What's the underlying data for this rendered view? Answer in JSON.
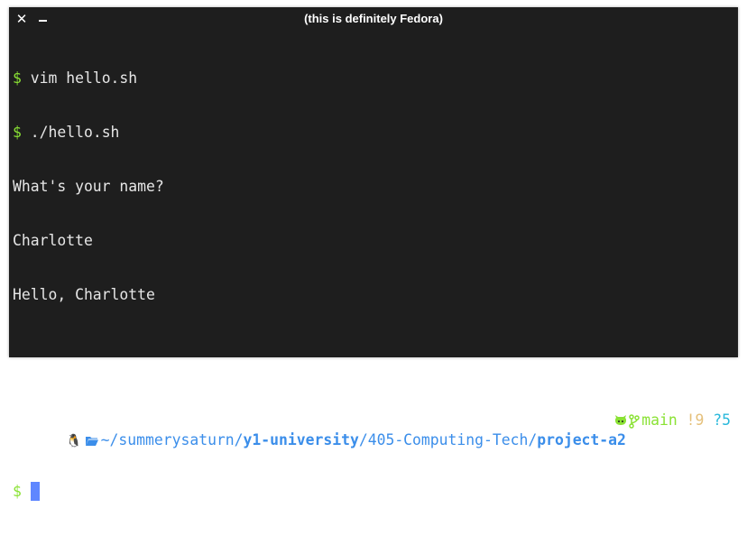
{
  "window": {
    "title": "(this is definitely Fedora)",
    "close_glyph": "✕",
    "minimize_glyph": ""
  },
  "history": [
    {
      "prompt": "$",
      "command": "vim hello.sh"
    },
    {
      "prompt": "$",
      "command": "./hello.sh"
    }
  ],
  "output": [
    "What's your name?",
    "Charlotte",
    "Hello, Charlotte"
  ],
  "prompt": {
    "os_icon": "penguin-icon",
    "folder_icon": "folder-icon",
    "path_home": "~/summerysaturn/",
    "path_bold1": "y1-university",
    "path_mid": "/405-Computing-Tech/",
    "path_bold2": "project-a2",
    "git_icon": "github-icon",
    "branch_icon": "git-branch-icon",
    "branch": "main",
    "modified": "!9",
    "untracked": "?5",
    "symbol": "$"
  },
  "colors": {
    "background": "#1e1e1e",
    "prompt_symbol": "#8ae234",
    "path": "#3b8eea",
    "branch": "#8ae234",
    "modified": "#e5c07b",
    "untracked": "#29b8db",
    "cursor": "#5f87ff"
  }
}
